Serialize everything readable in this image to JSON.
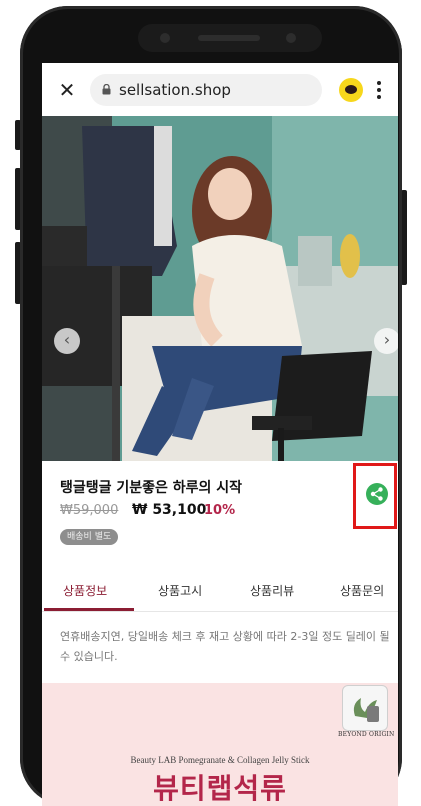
{
  "browser": {
    "url": "sellsation.shop"
  },
  "icons": {
    "close": "close-icon",
    "lock": "lock-icon",
    "kakao": "kakaotalk-icon",
    "more": "more-vertical-icon",
    "share": "share-icon",
    "prev": "chevron-left-icon",
    "next": "chevron-right-icon"
  },
  "product": {
    "title": "탱글탱글 기분좋은 하루의 시작",
    "original_price": "₩59,000",
    "sale_price": "₩ 53,100",
    "discount": "10%",
    "badge": "배송비 별도"
  },
  "tabs": [
    {
      "label": "상품정보",
      "active": true
    },
    {
      "label": "상품고시",
      "active": false
    },
    {
      "label": "상품리뷰",
      "active": false
    },
    {
      "label": "상품문의",
      "active": false
    }
  ],
  "notice": "연휴배송지연, 당일배송 체크 후 재고 상황에 따라 2-3일 정도 딜레이 될 수 있습니다.",
  "banner": {
    "brand": "BEYOND ORIGIN",
    "subtitle": "Beauty LAB Pomegranate & Collagen Jelly Stick",
    "title": "뷰티랩석류"
  },
  "colors": {
    "accent": "#8b1d33",
    "discount": "#b3254a",
    "share_green": "#36b05a",
    "highlight": "#e01818",
    "banner_bg": "#fae3e3"
  }
}
